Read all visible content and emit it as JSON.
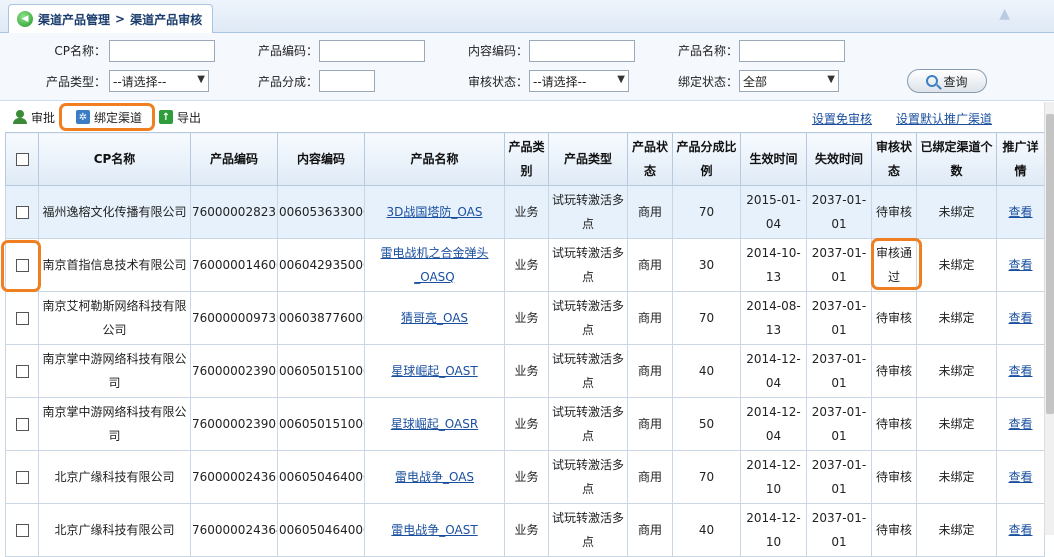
{
  "tab": {
    "part1": "渠道产品管理",
    "sep": " > ",
    "part2": "渠道产品审核"
  },
  "search": {
    "cp_name_label": "CP名称：",
    "product_code_label": "产品编码：",
    "content_code_label": "内容编码：",
    "product_name_label": "产品名称：",
    "product_type_label": "产品类型：",
    "product_type_value": "--请选择--",
    "product_share_label": "产品分成：",
    "audit_status_label": "审核状态：",
    "audit_status_value": "--请选择--",
    "bind_status_label": "绑定状态：",
    "bind_status_value": "全部",
    "query_label": "查询"
  },
  "toolbar": {
    "approve_label": "审批",
    "bind_channel_label": "绑定渠道",
    "export_label": "导出",
    "set_exempt_label": "设置免审核",
    "set_default_label": "设置默认推广渠道"
  },
  "table": {
    "headers": [
      "CP名称",
      "产品编码",
      "内容编码",
      "产品名称",
      "产品类别",
      "产品类型",
      "产品状态",
      "产品分成比例",
      "生效时间",
      "失效时间",
      "审核状态",
      "已绑定渠道个数",
      "推广详情"
    ],
    "rows": [
      {
        "cp": "福州逸榕文化传播有限公司",
        "pcode": "760000028233",
        "ccode": "006053633000",
        "pname": "3D战国塔防_OAS",
        "cat": "业务",
        "ptype": "试玩转激活多点",
        "pstatus": "商用",
        "share": "70",
        "start": "2015-01-04",
        "end": "2037-01-01",
        "audit": "待审核",
        "bound": "未绑定",
        "detail": "查看"
      },
      {
        "cp": "南京首指信息技术有限公司",
        "pcode": "760000014600",
        "ccode": "006042935000",
        "pname": "雷电战机之合金弹头_OASQ",
        "cat": "业务",
        "ptype": "试玩转激活多点",
        "pstatus": "商用",
        "share": "30",
        "start": "2014-10-13",
        "end": "2037-01-01",
        "audit": "审核通过",
        "bound": "未绑定",
        "detail": "查看"
      },
      {
        "cp": "南京艾柯勒斯网络科技有限公司",
        "pcode": "760000009733",
        "ccode": "006038776000",
        "pname": "猜哥亮_OAS",
        "cat": "业务",
        "ptype": "试玩转激活多点",
        "pstatus": "商用",
        "share": "70",
        "start": "2014-08-13",
        "end": "2037-01-01",
        "audit": "待审核",
        "bound": "未绑定",
        "detail": "查看"
      },
      {
        "cp": "南京掌中游网络科技有限公司",
        "pcode": "760000023903",
        "ccode": "006050151000",
        "pname": "星球崛起_OAST",
        "cat": "业务",
        "ptype": "试玩转激活多点",
        "pstatus": "商用",
        "share": "40",
        "start": "2014-12-04",
        "end": "2037-01-01",
        "audit": "待审核",
        "bound": "未绑定",
        "detail": "查看"
      },
      {
        "cp": "南京掌中游网络科技有限公司",
        "pcode": "760000023905",
        "ccode": "006050151000",
        "pname": "星球崛起_OASR",
        "cat": "业务",
        "ptype": "试玩转激活多点",
        "pstatus": "商用",
        "share": "50",
        "start": "2014-12-04",
        "end": "2037-01-01",
        "audit": "待审核",
        "bound": "未绑定",
        "detail": "查看"
      },
      {
        "cp": "北京广缘科技有限公司",
        "pcode": "760000024363",
        "ccode": "006050464000",
        "pname": "雷电战争_OAS",
        "cat": "业务",
        "ptype": "试玩转激活多点",
        "pstatus": "商用",
        "share": "70",
        "start": "2014-12-10",
        "end": "2037-01-01",
        "audit": "待审核",
        "bound": "未绑定",
        "detail": "查看"
      },
      {
        "cp": "北京广缘科技有限公司",
        "pcode": "760000024364",
        "ccode": "006050464000",
        "pname": "雷电战争_OAST",
        "cat": "业务",
        "ptype": "试玩转激活多点",
        "pstatus": "商用",
        "share": "40",
        "start": "2014-12-10",
        "end": "2037-01-01",
        "audit": "待审核",
        "bound": "未绑定",
        "detail": "查看"
      }
    ]
  },
  "colors": {
    "highlight": "#f07f21",
    "link": "#1a4fa0",
    "header_bg": "#dfeaf6"
  }
}
